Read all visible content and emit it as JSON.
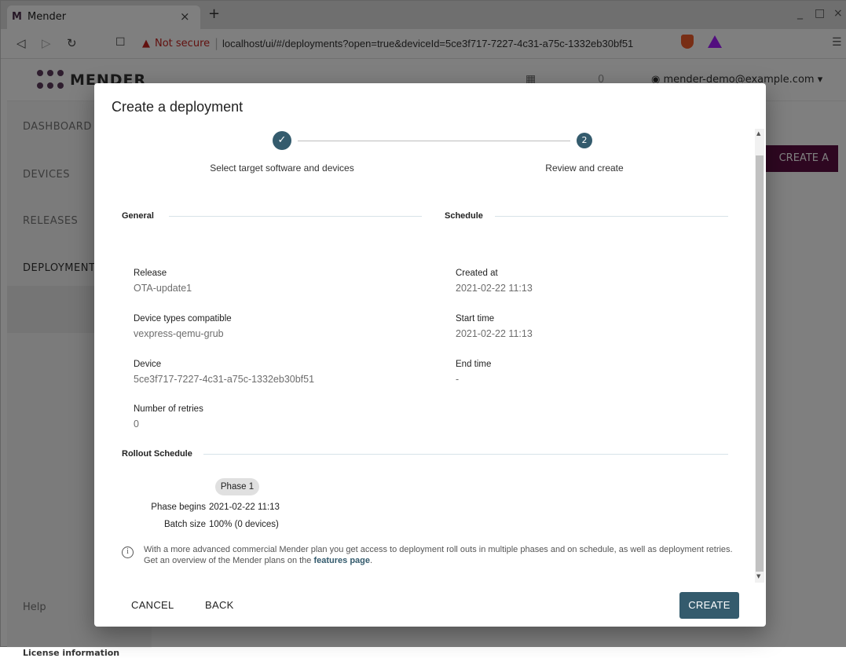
{
  "browser": {
    "tab_title": "Mender",
    "tab_favicon": "M",
    "tab_close": "×",
    "new_tab": "+",
    "minimize": "_",
    "maximize": "□",
    "close": "×",
    "not_secure": "Not secure",
    "url": "localhost/ui/#/deployments?open=true&deviceId=5ce3f717-7227-4c31-a75c-1332eb30bf51"
  },
  "app": {
    "logo_text": "MENDER",
    "user_email": "mender-demo@example.com",
    "counter": "0",
    "sidebar": [
      "DASHBOARD",
      "DEVICES",
      "RELEASES",
      "DEPLOYMENTS"
    ],
    "help": "Help",
    "license": "License information",
    "create_deployment_button": "CREATE A DEPLOYMENT"
  },
  "dialog": {
    "title": "Create a deployment",
    "steps": [
      {
        "label": "Select target software and devices",
        "state": "done"
      },
      {
        "label": "Review and create",
        "number": "2",
        "state": "active"
      }
    ],
    "general": {
      "title": "General",
      "fields": [
        {
          "label": "Release",
          "value": "OTA-update1"
        },
        {
          "label": "Device types compatible",
          "value": "vexpress-qemu-grub"
        },
        {
          "label": "Device",
          "value": "5ce3f717-7227-4c31-a75c-1332eb30bf51"
        },
        {
          "label": "Number of retries",
          "value": "0"
        }
      ]
    },
    "schedule": {
      "title": "Schedule",
      "fields": [
        {
          "label": "Created at",
          "value": "2021-02-22 11:13"
        },
        {
          "label": "Start time",
          "value": "2021-02-22 11:13"
        },
        {
          "label": "End time",
          "value": "-"
        }
      ]
    },
    "rollout": {
      "title": "Rollout Schedule",
      "phase_label": "Phase 1",
      "phase_begins_label": "Phase begins",
      "phase_begins_value": "2021-02-22 11:13",
      "batch_size_label": "Batch size",
      "batch_size_value": "100% (0 devices)"
    },
    "info": {
      "text": "With a more advanced commercial Mender plan you get access to deployment roll outs in multiple phases and on schedule, as well as deployment retries. Get an overview of the Mender plans on the ",
      "link": "features page",
      "suffix": "."
    },
    "buttons": {
      "cancel": "CANCEL",
      "back": "BACK",
      "create": "CREATE"
    }
  },
  "colors": {
    "primary": "#345b6d",
    "brand": "#5d0f43",
    "warning": "#c5221f"
  }
}
